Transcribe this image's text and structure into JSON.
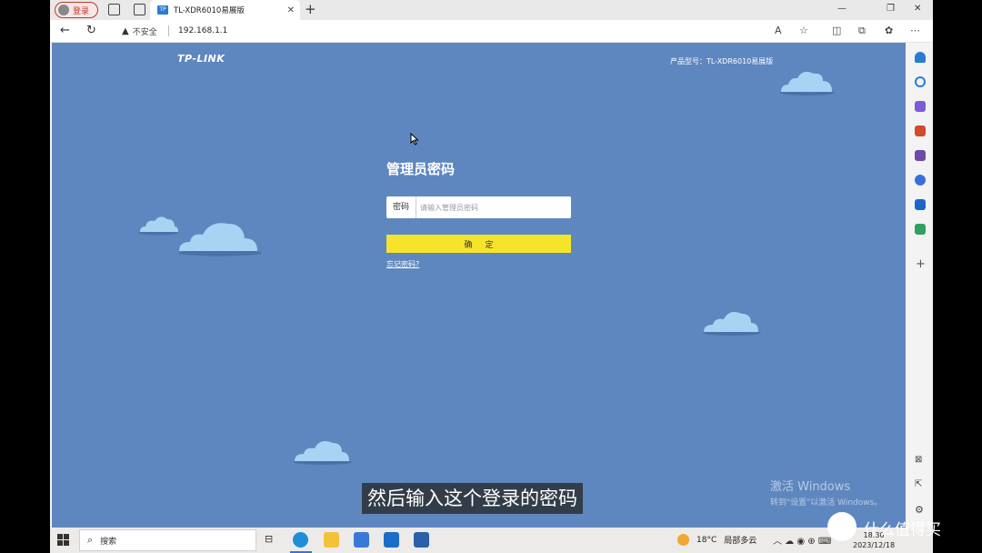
{
  "browser": {
    "profile_label": "登录",
    "tab_title": "TL-XDR6010易展版",
    "tab_favicon": "TP",
    "new_tab_icon": "plus-icon",
    "security_label": "不安全",
    "url": "192.168.1.1"
  },
  "page": {
    "brand": "TP-LINK",
    "model": "产品型号：TL-XDR6010易展版",
    "login_title": "管理员密码",
    "password_label": "密码",
    "password_placeholder": "请输入管理员密码",
    "password_value": "",
    "confirm_label": "确定",
    "forgot_link": "忘记密码?",
    "background_color": "#5e87bf",
    "button_color": "#f6e42a"
  },
  "watermark": {
    "line1": "激活 Windows",
    "line2": "转到\"设置\"以激活 Windows。"
  },
  "subtitle": "然后输入这个登录的密码",
  "taskbar": {
    "search_label": "搜索",
    "weather_temp": "18°C",
    "weather_desc": "局部多云",
    "time": "18:30",
    "date": "2023/12/18"
  },
  "overlay_brand": "什么值得买"
}
